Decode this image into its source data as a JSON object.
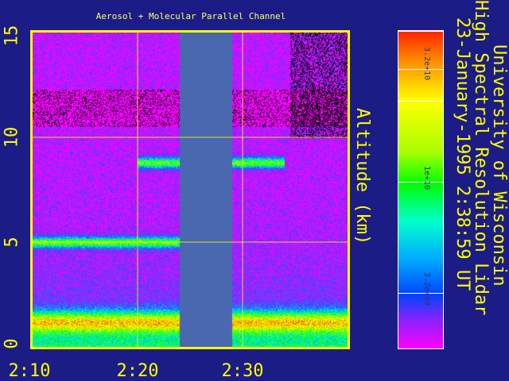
{
  "header": {
    "title": "Aerosol + Molecular Parallel Channel"
  },
  "side_titles": {
    "line1": "University of Wisconsin",
    "line2": "High Spectral Resolution Lidar",
    "line3": "23-January-1995   2:38:59 UT"
  },
  "colorbar": {
    "scale": "log",
    "tick_labels": [
      "3.2e+10",
      "1e+10",
      "3.2e+09"
    ],
    "top_color": "#ff2200",
    "bottom_color": "#ff00ff"
  },
  "chart_data": {
    "type": "heatmap",
    "title": "Aerosol + Molecular Parallel Channel",
    "ylabel": "Altitude (km)",
    "xlabel": "",
    "x_tick_labels": [
      "2:10",
      "2:20",
      "2:30"
    ],
    "y_tick_labels": [
      "0",
      "5",
      "10",
      "15"
    ],
    "x_ticks": [
      "2:10",
      "2:20",
      "2:30"
    ],
    "y_ticks_km": [
      0,
      5,
      10,
      15
    ],
    "xlim": [
      "2:10",
      "2:40"
    ],
    "ylim_km": [
      0,
      15
    ],
    "grid": true,
    "no_data_interval": [
      "2:24",
      "2:29"
    ],
    "features": [
      {
        "label": "aerosol layer",
        "time_start": "2:10",
        "time_end": "2:24",
        "altitude_km": 5.0
      },
      {
        "label": "cirrus layer",
        "time_start": "2:20",
        "time_end": "2:34",
        "altitude_km": 8.8
      },
      {
        "label": "boundary layer",
        "time_start": "2:10",
        "time_end": "2:40",
        "altitude_km": 1.2
      }
    ]
  }
}
